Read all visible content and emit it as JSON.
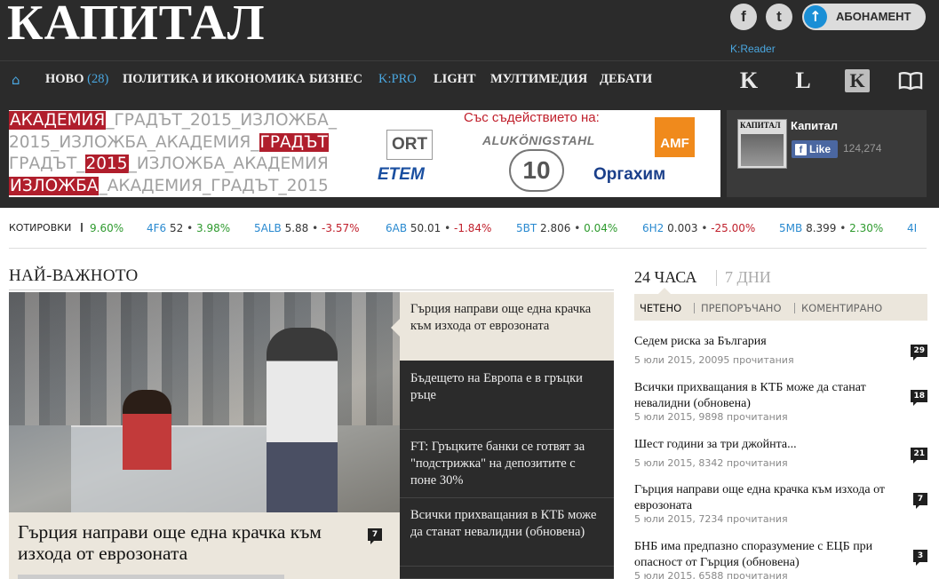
{
  "header": {
    "logo": "КАПИТАЛ",
    "facebook_glyph": "f",
    "twitter_glyph": "t",
    "subscribe_label": "АБОНАМЕНТ",
    "subscribe_glyph": "↑",
    "kreader_label": "K:Reader"
  },
  "nav": {
    "home_glyph": "⌂",
    "items": [
      {
        "label": "НОВО",
        "count": "(28)"
      },
      {
        "label": "ПОЛИТИКА И ИКОНОМИКА"
      },
      {
        "label": "БИЗНЕС"
      },
      {
        "label": "K:PRO"
      },
      {
        "label": "LIGHT"
      },
      {
        "label": "МУЛТИМЕДИЯ"
      },
      {
        "label": "ДЕБАТИ"
      }
    ],
    "icons": [
      "K",
      "L",
      "K",
      "book-icon"
    ]
  },
  "ad": {
    "lines": [
      [
        "АКАДЕМИЯ",
        "_ГРАДЪТ_2015_ИЗЛОЖБА_"
      ],
      [
        "2015_ИЗЛОЖБА_АКАДЕМИЯ_",
        "ГРАДЪТ"
      ],
      [
        "ГРАДЪТ_",
        "2015",
        "_ИЗЛОЖБА_АКАДЕМИЯ"
      ],
      [
        "ИЗЛОЖБА",
        "_АКАДЕМИЯ_ГРАДЪТ_2015"
      ]
    ],
    "support_text": "Със съдействието на:",
    "sponsors": [
      "ORT",
      "ALUKÖNIGSTAHL",
      "AMF",
      "ETEM",
      "10",
      "Оргахим"
    ]
  },
  "fb_box": {
    "thumb_title": "КАПИТАЛ",
    "page_name": "Капитал",
    "like_glyph": "f",
    "like_label": "Like",
    "like_count": "124,274"
  },
  "ticker": {
    "label": "КОТИРОВКИ",
    "first_change": "9.60%",
    "quotes": [
      {
        "code": "4F6",
        "price": "52",
        "change": "3.98%",
        "dir": "up"
      },
      {
        "code": "5ALB",
        "price": "5.88",
        "change": "-3.57%",
        "dir": "down"
      },
      {
        "code": "6AB",
        "price": "50.01",
        "change": "-1.84%",
        "dir": "down"
      },
      {
        "code": "5BT",
        "price": "2.806",
        "change": "0.04%",
        "dir": "up"
      },
      {
        "code": "6H2",
        "price": "0.003",
        "change": "-25.00%",
        "dir": "down"
      },
      {
        "code": "5MB",
        "price": "8.399",
        "change": "2.30%",
        "dir": "up"
      },
      {
        "code": "4I",
        "price": "",
        "change": "",
        "dir": "up"
      }
    ]
  },
  "main": {
    "section_title": "НАЙ-ВАЖНОТО",
    "hero_title": "Гърция направи още една крачка към изхода от еврозоната",
    "hero_comments": "7",
    "stories": [
      "Гърция направи още една крачка към изхода от еврозоната",
      "Бъдещето на Европа е в гръцки ръце",
      "FT: Гръцките банки се готвят за \"подстрижка\" на депозитите с поне 30%",
      "Всички прихващания в КТБ може да станат невалидни (обновена)",
      ""
    ]
  },
  "sidebar": {
    "tab_24": "24 ЧАСА",
    "tab_7": "7 ДНИ",
    "subtabs": [
      "ЧЕТЕНО",
      "ПРЕПОРЪЧАНО",
      "КОМЕНТИРАНО"
    ],
    "items": [
      {
        "title": "Седем риска за България",
        "meta": "5 юли 2015, 20095 прочитания",
        "comments": "29"
      },
      {
        "title": "Всички прихващания в КТБ може да станат невалидни (обновена)",
        "meta": "5 юли 2015, 9898 прочитания",
        "comments": "18"
      },
      {
        "title": "Шест години за три джойнта...",
        "meta": "5 юли 2015, 8342 прочитания",
        "comments": "21"
      },
      {
        "title": "Гърция направи още една крачка към изхода от еврозоната",
        "meta": "5 юли 2015, 7234 прочитания",
        "comments": "7"
      },
      {
        "title": "БНБ има предпазно споразумение с ЕЦБ при опасност от Гърция (обновена)",
        "meta": "5 юли 2015, 6588 прочитания",
        "comments": "3"
      }
    ]
  }
}
